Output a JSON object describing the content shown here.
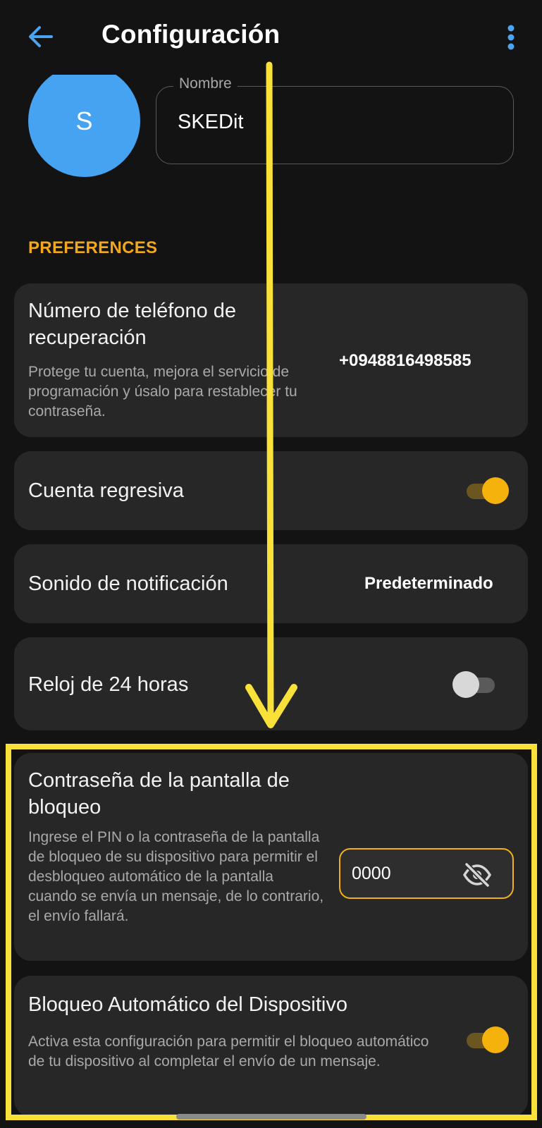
{
  "header": {
    "title": "Configuración",
    "back_icon": "arrow-left-icon",
    "menu_icon": "more-vertical-icon"
  },
  "profile": {
    "avatar_initial": "S",
    "avatar_color": "#46a3f2",
    "name_label": "Nombre",
    "name_value": "SKEDit"
  },
  "section": {
    "title": "PREFERENCES",
    "accent_color": "#f0a81e"
  },
  "settings": {
    "recovery_phone": {
      "title": "Número de teléfono de recuperación",
      "description": "Protege tu cuenta, mejora el servicio de programación y úsalo para restablecer tu contraseña.",
      "value": "+0948816498585"
    },
    "countdown": {
      "title": "Cuenta regresiva",
      "enabled": true
    },
    "notification_sound": {
      "title": "Sonido de notificación",
      "value": "Predeterminado"
    },
    "clock_24h": {
      "title": "Reloj de 24 horas",
      "enabled": false
    },
    "lock_screen_password": {
      "title": "Contraseña de la pantalla de bloqueo",
      "description": "Ingrese el PIN o la contraseña de la pantalla de bloqueo de su dispositivo para permitir el desbloqueo automático de la pantalla cuando se envía un mensaje, de lo contrario, el envío fallará.",
      "pin_value": "0000",
      "visibility_icon": "eye-off-icon"
    },
    "auto_lock": {
      "title": "Bloqueo Automático del Dispositivo",
      "description": "Activa esta configuración para permitir el bloqueo automático de tu dispositivo al completar el envío de un mensaje.",
      "enabled": true
    }
  },
  "annotation": {
    "color": "#f9e13a"
  }
}
